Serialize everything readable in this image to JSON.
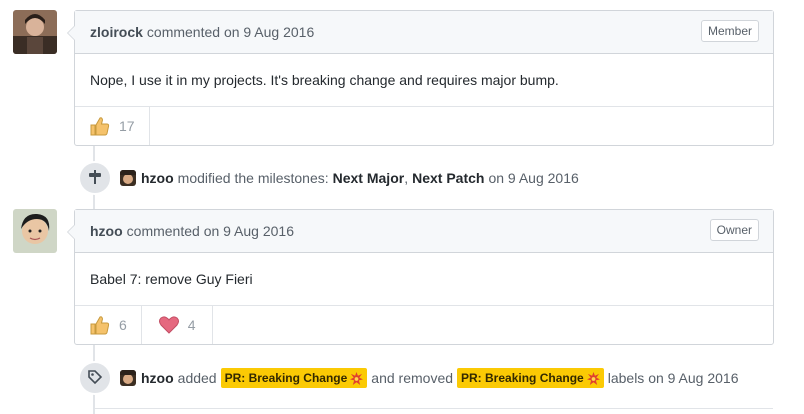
{
  "comments": [
    {
      "author": "zloirock",
      "meta": "commented on 9 Aug 2016",
      "role": "Member",
      "body": "Nope, I use it in my projects. It's breaking change and requires major bump.",
      "reactions": [
        {
          "emoji": "thumbs-up",
          "count": "17"
        }
      ]
    },
    {
      "author": "hzoo",
      "meta": "commented on 9 Aug 2016",
      "role": "Owner",
      "body": "Babel 7: remove Guy Fieri",
      "reactions": [
        {
          "emoji": "thumbs-up",
          "count": "6"
        },
        {
          "emoji": "heart",
          "count": "4"
        }
      ]
    }
  ],
  "events": [
    {
      "actor": "hzoo",
      "text_before": "modified the milestones:",
      "milestone1": "Next Major",
      "sep": ",",
      "milestone2": "Next Patch",
      "text_after": "on 9 Aug 2016"
    },
    {
      "actor": "hzoo",
      "text_added": "added",
      "label1": "PR: Breaking Change",
      "text_removed": "and removed",
      "label2": "PR: Breaking Change",
      "text_after": "labels on 9 Aug 2016"
    }
  ],
  "colors": {
    "label": "#fbca04",
    "heart": "#e5687f",
    "thumb": "#f5c26b"
  }
}
